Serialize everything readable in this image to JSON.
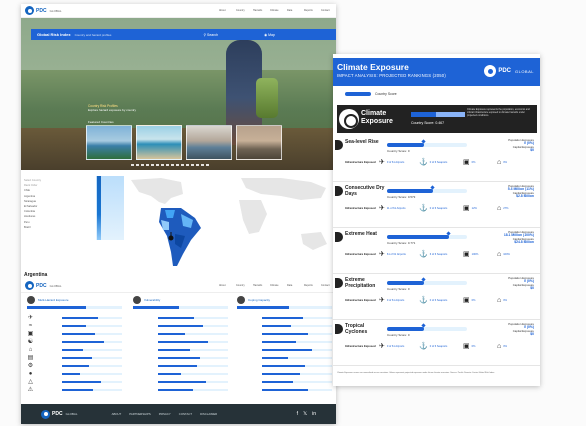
{
  "site": {
    "brand": "PDC",
    "brand_sub": "GLOBAL",
    "nav": [
      "About",
      "Country",
      "Hazards",
      "Climate",
      "Data",
      "Reports",
      "Contact"
    ],
    "hero": {
      "title": "Global Risk Index",
      "subtitle": "Country and hazard profiles",
      "search_label": "Search",
      "map_label": "Map",
      "caption_title": "Country Risk Profiles",
      "caption_text": "Explore hazard exposure by country",
      "thumbs_label": "Featured Countries"
    },
    "map": {
      "list_label_1": "Select Country",
      "list_label_2": "Rank Order",
      "countries": [
        "Chile",
        "Argentina",
        "Nicaragua",
        "El Salvador",
        "Colombia",
        "Honduras",
        "Peru",
        "Brazil"
      ]
    },
    "section_title": "Argentina",
    "triplets": [
      {
        "title": "Multi-Hazard Exposure",
        "fill": 0.62
      },
      {
        "title": "Vulnerability",
        "fill": 0.48
      },
      {
        "title": "Coping Capacity",
        "fill": 0.55
      }
    ],
    "footer_nav": [
      "ABOUT",
      "PARTNERSHIPS",
      "PRIVACY",
      "CONTACT",
      "DISCLAIMER"
    ]
  },
  "report": {
    "title": "Climate Exposure",
    "subtitle": "IMPACT ANALYSIS: PROJECTED RANKINGS (2050)",
    "logo_text": "PDC",
    "logo_global": "GLOBAL",
    "legend_label": "Country Score",
    "banner_title": "Climate Exposure",
    "banner_score": "Country Score: 0.467",
    "banner_fill": 0.46,
    "banner_desc": "Climate Exposure represents the population, economic and critical infrastructure exposed to climate hazards under projected conditions.",
    "infra_label": "Infrastructure Exposed",
    "hazards": [
      {
        "name": "Sea-level Rise",
        "score": "Country Score: 0",
        "fill": 0.46,
        "pop_label": "Population Exposure",
        "pop_value": "0 (0%)",
        "cap_label": "Capital Exposure",
        "cap_value": "$0",
        "airports": "0 of 61 Airports",
        "seaports": "0 of 6 Seaports",
        "hospitals": "0%",
        "schools": "0%"
      },
      {
        "name": "Consecutive Dry Days",
        "score": "Country Score: 0.573",
        "fill": 0.57,
        "pop_label": "Population Exposure",
        "pop_value": "5.4 Million (11%)",
        "cap_label": "Capital Exposure",
        "cap_value": "$2.8 Billion",
        "airports": "11 of 61 Airports",
        "seaports": "0 of 6 Seaports",
        "hospitals": "12%",
        "schools": "27%"
      },
      {
        "name": "Extreme Heat",
        "score": "Country Score: 0.771",
        "fill": 0.77,
        "pop_label": "Population Exposure",
        "pop_value": "18.1 Million (100%)",
        "cap_label": "Capital Exposure",
        "cap_value": "$24.8 Billion",
        "airports": "61 of 61 Airports",
        "seaports": "6 of 6 Seaports",
        "hospitals": "100%",
        "schools": "100%"
      },
      {
        "name": "Extreme Precipitation",
        "score": "Country Score: 0",
        "fill": 0.46,
        "pop_label": "Population Exposure",
        "pop_value": "0 (0%)",
        "cap_label": "Capital Exposure",
        "cap_value": "$0",
        "airports": "0 of 61 Airports",
        "seaports": "0 of 6 Seaports",
        "hospitals": "0%",
        "schools": "0%"
      },
      {
        "name": "Tropical Cyclones",
        "score": "Country Score: 0",
        "fill": 0.46,
        "pop_label": "Population Exposure",
        "pop_value": "0 (0%)",
        "cap_label": "Capital Exposure",
        "cap_value": "$0",
        "airports": "0 of 61 Airports",
        "seaports": "0 of 6 Seaports",
        "hospitals": "0%",
        "schools": "0%"
      }
    ],
    "footer_note": "Climate Exposure scores are normalized across countries. Values represent projected exposure under future climate scenarios. Source: Pacific Disaster Center Global Risk Index."
  },
  "colors": {
    "accent": "#1e63d6",
    "dark": "#222222",
    "footer": "#263238"
  }
}
